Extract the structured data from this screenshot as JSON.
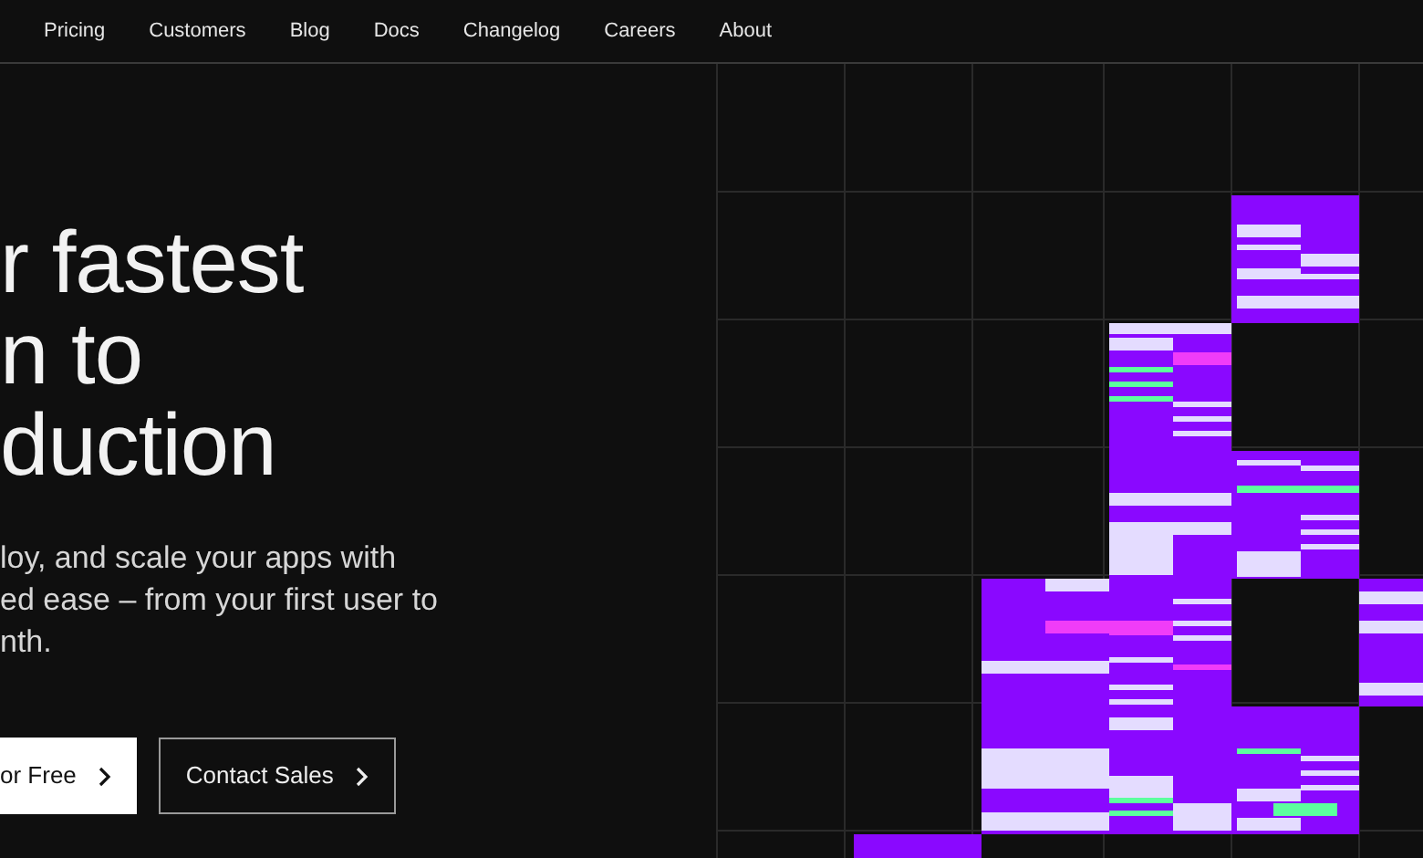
{
  "nav": {
    "links": [
      {
        "label": "Pricing"
      },
      {
        "label": "Customers"
      },
      {
        "label": "Blog"
      },
      {
        "label": "Docs"
      },
      {
        "label": "Changelog"
      },
      {
        "label": "Careers"
      },
      {
        "label": "About"
      }
    ]
  },
  "hero": {
    "headline_lines": [
      "r fastest",
      "n to",
      "duction"
    ],
    "description_lines": [
      "loy, and scale your apps with",
      "ed ease – from your first user to",
      "nth."
    ],
    "buttons": [
      {
        "label": "or Free",
        "kind": "primary"
      },
      {
        "label": "Contact Sales",
        "kind": "outline"
      }
    ]
  }
}
